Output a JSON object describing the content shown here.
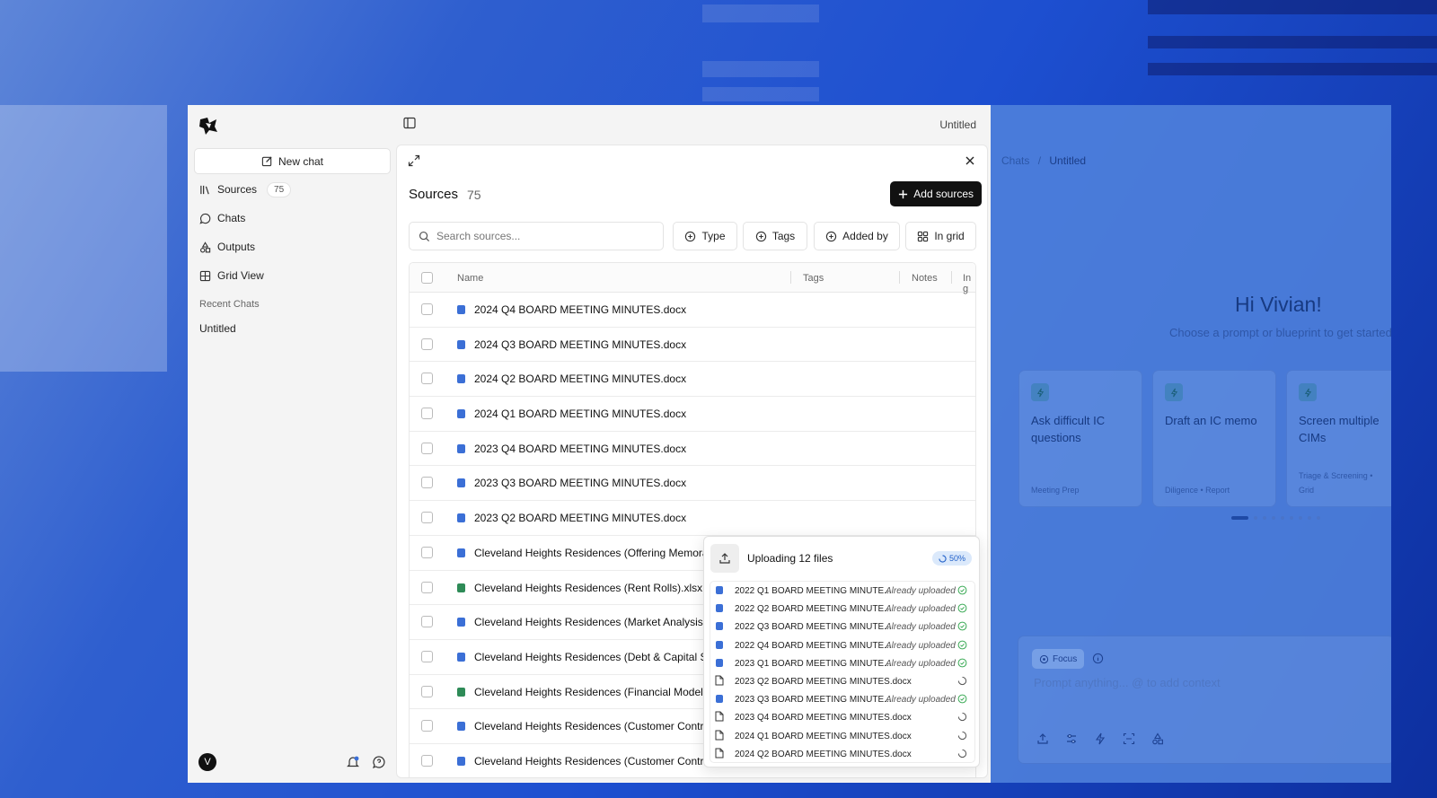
{
  "sidebar": {
    "new_chat": "New chat",
    "nav": [
      {
        "label": "Sources",
        "badge": "75",
        "icon": "library-icon"
      },
      {
        "label": "Chats",
        "icon": "chat-bubble-icon"
      },
      {
        "label": "Outputs",
        "icon": "shapes-icon"
      },
      {
        "label": "Grid View",
        "icon": "grid-icon"
      }
    ],
    "recent_title": "Recent Chats",
    "recent_items": [
      "Untitled"
    ],
    "avatar_initial": "V"
  },
  "header": {
    "title": "Untitled"
  },
  "sources_panel": {
    "title": "Sources",
    "count": "75",
    "add_button": "Add sources",
    "search_placeholder": "Search sources...",
    "filters": [
      "Type",
      "Tags",
      "Added by",
      "In grid"
    ],
    "columns": [
      "Name",
      "Tags",
      "Notes",
      "In g"
    ],
    "rows": [
      {
        "name": "2024 Q4 BOARD MEETING MINUTES.docx",
        "kind": "doc"
      },
      {
        "name": "2024 Q3 BOARD MEETING MINUTES.docx",
        "kind": "doc"
      },
      {
        "name": "2024 Q2 BOARD MEETING MINUTES.docx",
        "kind": "doc"
      },
      {
        "name": "2024 Q1 BOARD MEETING MINUTES.docx",
        "kind": "doc"
      },
      {
        "name": "2023 Q4 BOARD MEETING MINUTES.docx",
        "kind": "doc"
      },
      {
        "name": "2023 Q3 BOARD MEETING MINUTES.docx",
        "kind": "doc"
      },
      {
        "name": "2023 Q2 BOARD MEETING MINUTES.docx",
        "kind": "doc"
      },
      {
        "name": "Cleveland Heights Residences (Offering Memorand",
        "kind": "doc"
      },
      {
        "name": "Cleveland Heights Residences (Rent Rolls).xlsx",
        "kind": "xls"
      },
      {
        "name": "Cleveland Heights Residences (Market Analysis).d",
        "kind": "doc"
      },
      {
        "name": "Cleveland Heights Residences (Debt & Capital Stru",
        "kind": "doc"
      },
      {
        "name": "Cleveland Heights Residences (Financial Model).xl",
        "kind": "xls"
      },
      {
        "name": "Cleveland Heights Residences (Customer Contrac",
        "kind": "doc"
      },
      {
        "name": "Cleveland Heights Residences (Customer Contrac",
        "kind": "doc"
      }
    ]
  },
  "upload": {
    "title": "Uploading 12 files",
    "progress_label": "50%",
    "progress": 0.5,
    "items": [
      {
        "name": "2022 Q1 BOARD MEETING MINUTE...",
        "status": "Already uploaded",
        "state": "done"
      },
      {
        "name": "2022 Q2 BOARD MEETING MINUTE...",
        "status": "Already uploaded",
        "state": "done"
      },
      {
        "name": "2022 Q3 BOARD MEETING MINUTE...",
        "status": "Already uploaded",
        "state": "done"
      },
      {
        "name": "2022 Q4 BOARD MEETING MINUTE...",
        "status": "Already uploaded",
        "state": "done"
      },
      {
        "name": "2023 Q1 BOARD MEETING MINUTE...",
        "status": "Already uploaded",
        "state": "done"
      },
      {
        "name": "2023 Q2 BOARD MEETING MINUTES.docx",
        "status": "",
        "state": "loading"
      },
      {
        "name": "2023 Q3 BOARD MEETING MINUTE...",
        "status": "Already uploaded",
        "state": "done"
      },
      {
        "name": "2023 Q4 BOARD MEETING MINUTES.docx",
        "status": "",
        "state": "loading"
      },
      {
        "name": "2024 Q1 BOARD MEETING MINUTES.docx",
        "status": "",
        "state": "loading"
      },
      {
        "name": "2024 Q2 BOARD MEETING MINUTES.docx",
        "status": "",
        "state": "loading"
      }
    ]
  },
  "right": {
    "breadcrumb_root": "Chats",
    "breadcrumb_sep": "/",
    "breadcrumb_current": "Untitled",
    "greeting": "Hi Vivian!",
    "subtitle": "Choose a prompt or blueprint to get started",
    "cards": [
      {
        "title": "Ask difficult IC questions",
        "tags": "Meeting Prep"
      },
      {
        "title": "Draft an IC memo",
        "tags": "Diligence •  Report"
      },
      {
        "title": "Screen multiple CIMs",
        "tags": "Triage & Screening •"
      }
    ],
    "card3_extra_tag": "Grid",
    "focus_label": "Focus",
    "prompt_placeholder": "Prompt anything... @ to add context"
  },
  "colors": {
    "accent": "#111111",
    "doc_blue": "#3b6fd6",
    "xls_green": "#2e8b57",
    "success": "#3aaa55",
    "background_blue": "#1d4fd0"
  }
}
